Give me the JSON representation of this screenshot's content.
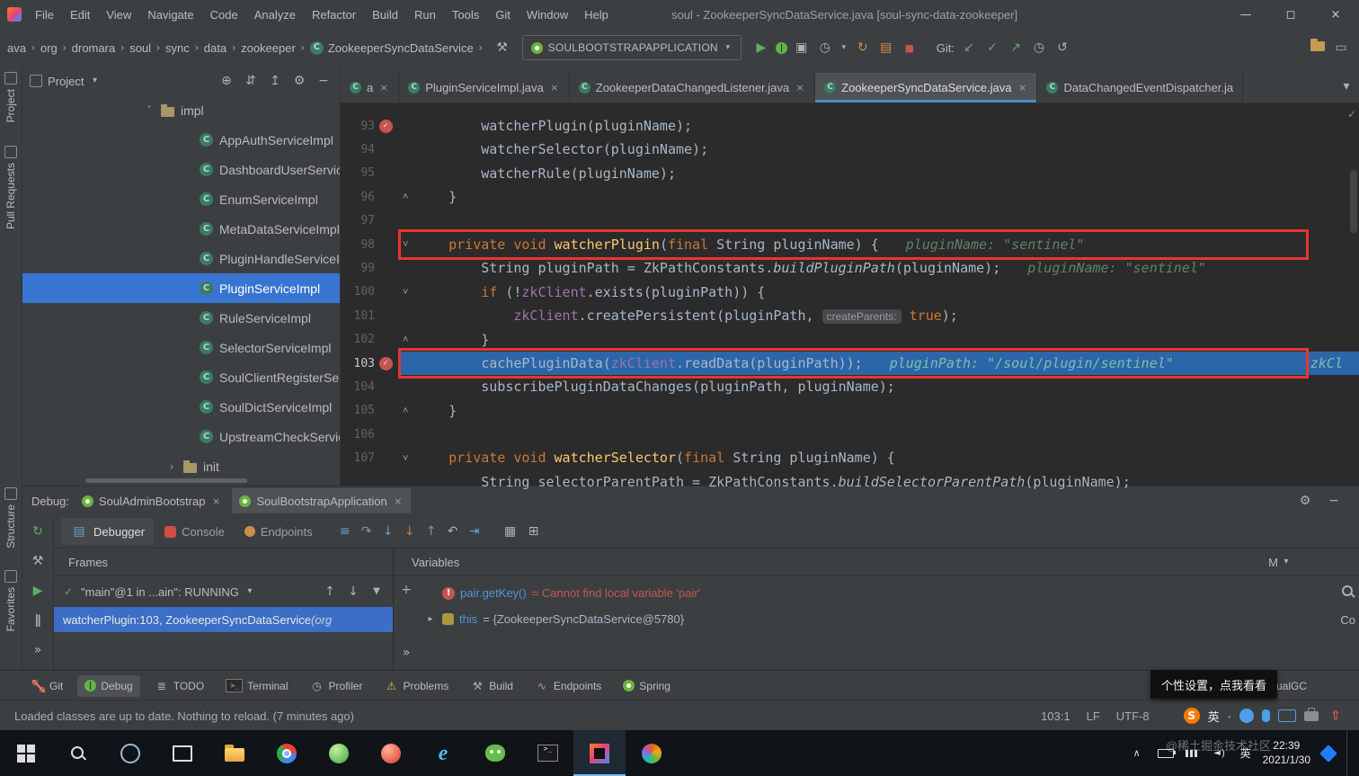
{
  "window_title": "soul - ZookeeperSyncDataService.java [soul-sync-data-zookeeper]",
  "menu_bar": [
    "File",
    "Edit",
    "View",
    "Navigate",
    "Code",
    "Analyze",
    "Refactor",
    "Build",
    "Run",
    "Tools",
    "Git",
    "Window",
    "Help"
  ],
  "nav": {
    "breadcrumbs": [
      "ava",
      "org",
      "dromara",
      "soul",
      "sync",
      "data",
      "zookeeper"
    ],
    "breadcrumb_class": "ZookeeperSyncDataService",
    "run_config": "SOULBOOTSTRAPAPPLICATION",
    "git_label": "Git:"
  },
  "stripes": {
    "top": [
      "Project",
      "Pull Requests"
    ],
    "bottom": [
      "Structure",
      "Favorites"
    ]
  },
  "project": {
    "title": "Project",
    "folder": "impl",
    "classes": [
      "AppAuthServiceImpl",
      "DashboardUserServiceI",
      "EnumServiceImpl",
      "MetaDataServiceImpl",
      "PluginHandleServiceIm",
      "PluginServiceImpl",
      "RuleServiceImpl",
      "SelectorServiceImpl",
      "SoulClientRegisterServ",
      "SoulDictServiceImpl",
      "UpstreamCheckService"
    ],
    "selected": "PluginServiceImpl",
    "trailing_folder": "init"
  },
  "editor": {
    "tabs": [
      {
        "label": "a",
        "close": true
      },
      {
        "label": "PluginServiceImpl.java",
        "close": true
      },
      {
        "label": "ZookeeperDataChangedListener.java",
        "close": true
      },
      {
        "label": "ZookeeperSyncDataService.java",
        "close": true,
        "active": true
      },
      {
        "label": "DataChangedEventDispatcher.ja",
        "close": false
      }
    ],
    "lines": [
      {
        "n": "93",
        "bp": true,
        "seg": [
          [
            "p",
            "        watcherPlugin(pluginName);"
          ]
        ]
      },
      {
        "n": "94",
        "seg": [
          [
            "p",
            "        watcherSelector(pluginName);"
          ]
        ]
      },
      {
        "n": "95",
        "seg": [
          [
            "p",
            "        watcherRule(pluginName);"
          ]
        ]
      },
      {
        "n": "96",
        "fold": "up",
        "seg": [
          [
            "p",
            "    }"
          ]
        ]
      },
      {
        "n": "97",
        "seg": []
      },
      {
        "n": "98",
        "fold": "down",
        "box": true,
        "seg": [
          [
            "p",
            "    "
          ],
          [
            "k",
            "private"
          ],
          [
            "p",
            " "
          ],
          [
            "k",
            "void"
          ],
          [
            "p",
            " "
          ],
          [
            "d",
            "watcherPlugin"
          ],
          [
            "p",
            "("
          ],
          [
            "k",
            "final"
          ],
          [
            "p",
            " String pluginName) {"
          ],
          [
            "h",
            "pluginName: \"sentinel\""
          ]
        ]
      },
      {
        "n": "99",
        "seg": [
          [
            "p",
            "        String pluginPath = ZkPathConstants."
          ],
          [
            "s",
            "buildPluginPath"
          ],
          [
            "p",
            "(pluginName);"
          ],
          [
            "h",
            "pluginName: \"sentinel\""
          ]
        ]
      },
      {
        "n": "100",
        "fold": "down",
        "seg": [
          [
            "p",
            "        "
          ],
          [
            "k",
            "if"
          ],
          [
            "p",
            " (!"
          ],
          [
            "f",
            "zkClient"
          ],
          [
            "p",
            ".exists(pluginPath)) {"
          ]
        ]
      },
      {
        "n": "101",
        "seg": [
          [
            "p",
            "            "
          ],
          [
            "f",
            "zkClient"
          ],
          [
            "p",
            ".createPersistent(pluginPath, "
          ],
          [
            "b",
            "createParents:"
          ],
          [
            "p",
            " "
          ],
          [
            "k",
            "true"
          ],
          [
            "p",
            ");"
          ]
        ]
      },
      {
        "n": "102",
        "fold": "up",
        "seg": [
          [
            "p",
            "        }"
          ]
        ]
      },
      {
        "n": "103",
        "bp": true,
        "exec": true,
        "box": true,
        "rhint": "zkCl",
        "seg": [
          [
            "p",
            "        cachePluginData("
          ],
          [
            "f",
            "zkClient"
          ],
          [
            "p",
            ".readData(pluginPath));"
          ],
          [
            "hx",
            "pluginPath: \"/soul/plugin/sentinel\""
          ]
        ]
      },
      {
        "n": "104",
        "seg": [
          [
            "p",
            "        subscribePluginDataChanges(pluginPath, pluginName);"
          ]
        ]
      },
      {
        "n": "105",
        "fold": "up",
        "seg": [
          [
            "p",
            "    }"
          ]
        ]
      },
      {
        "n": "106",
        "seg": []
      },
      {
        "n": "107",
        "fold": "down",
        "seg": [
          [
            "p",
            "    "
          ],
          [
            "k",
            "private"
          ],
          [
            "p",
            " "
          ],
          [
            "k",
            "void"
          ],
          [
            "p",
            " "
          ],
          [
            "d",
            "watcherSelector"
          ],
          [
            "p",
            "("
          ],
          [
            "k",
            "final"
          ],
          [
            "p",
            " String pluginName) {"
          ]
        ]
      },
      {
        "n": "",
        "partial": true,
        "seg": [
          [
            "p",
            "        String selectorParentPath = ZkPathConstants."
          ],
          [
            "s",
            "buildSelectorParentPath"
          ],
          [
            "p",
            "(pluginName);"
          ]
        ]
      }
    ]
  },
  "debug": {
    "label": "Debug:",
    "sessions": [
      {
        "label": "SoulAdminBootstrap"
      },
      {
        "label": "SoulBootstrapApplication",
        "active": true
      }
    ],
    "views": [
      {
        "label": "Debugger",
        "icon": "debugger",
        "active": true
      },
      {
        "label": "Console",
        "icon": "console"
      },
      {
        "label": "Endpoints",
        "icon": "endpoint"
      }
    ],
    "frames": {
      "title": "Frames",
      "thread": "\"main\"@1 in ...ain\": RUNNING",
      "frame": "watcherPlugin:103, ZookeeperSyncDataService ",
      "frame_suffix": "(org"
    },
    "variables": {
      "title": "Variables",
      "memory_label": "M",
      "side_label": "Co",
      "rows": [
        {
          "name": "pair.getKey()",
          "sep": " = ",
          "value": "Cannot find local variable 'pair'",
          "error": true
        },
        {
          "name": "this",
          "sep": " = ",
          "value": "{ZookeeperSyncDataService@5780}",
          "expandable": true
        }
      ]
    }
  },
  "tool_bar": {
    "items": [
      {
        "label": "Git",
        "icon": "git-branch"
      },
      {
        "label": "Debug",
        "icon": "debug-bug",
        "active": true
      },
      {
        "label": "TODO",
        "icon": "todo"
      },
      {
        "label": "Terminal",
        "icon": "terminal"
      },
      {
        "label": "Profiler",
        "icon": "profiler"
      },
      {
        "label": "Problems",
        "icon": "problems"
      },
      {
        "label": "Build",
        "icon": "build-hammer"
      },
      {
        "label": "Endpoints",
        "icon": "endpoints"
      },
      {
        "label": "Spring",
        "icon": "spring"
      }
    ],
    "right_label": "VisualGC"
  },
  "tooltip": "个性设置，点我看看",
  "status": {
    "message": "Loaded classes are up to date. Nothing to reload. (7 minutes ago)",
    "caret": "103:1",
    "line_sep": "LF",
    "encoding": "UTF-8",
    "ime": "英"
  },
  "taskbar": {
    "ime": "英",
    "time": "22:39",
    "date": "2021/1/30",
    "watermark": "@稀土掘金技术社区"
  },
  "icons": {
    "window_controls": [
      "win-min",
      "win-max",
      "win-close"
    ],
    "nav_left": [
      "build-hammer"
    ],
    "nav_run": [
      "run",
      "debug-bug",
      "coverage",
      "profiler"
    ],
    "nav_extra": [
      "hot-swap",
      "thread-dump",
      "stop"
    ],
    "nav_git": [
      "update",
      "commit",
      "push",
      "history",
      "rollback"
    ],
    "nav_end": [
      "folder",
      "monitor"
    ],
    "project_header": [
      "locate",
      "expand-all",
      "collapse-all",
      "gear",
      "hide"
    ],
    "debug_left": [
      "rerun",
      "build-hammer",
      "resume",
      "pause",
      "more"
    ],
    "debug_header_right": [
      "gear",
      "hide"
    ],
    "debug_steps": [
      "show-exec",
      "step-over",
      "step-into",
      "force-step-into",
      "step-out",
      "drop-frame",
      "run-to-cursor"
    ],
    "debug_aux": [
      "evaluate",
      "layout"
    ],
    "frames_toolbar": [
      "up",
      "down",
      "filter"
    ],
    "variables_side": [
      "add",
      "more"
    ],
    "variables_right": [
      "search"
    ],
    "sogou": [
      "emoji",
      "mic",
      "keyboard",
      "toolbox",
      "skin"
    ],
    "taskbar_apps": [
      "start",
      "tsearch",
      "cortana",
      "task-view",
      "explorer",
      "chrome",
      "sphere",
      "browser-red",
      "ie",
      "wechat",
      "cmd",
      "idea",
      "media"
    ],
    "taskbar_active": "idea",
    "tray": [
      "tray-expand",
      "battery",
      "network",
      "volume"
    ]
  },
  "colors": {
    "accent_blue": "#4A88C7",
    "exec_line": "#2D65A9",
    "selection_blue": "#3875D1",
    "breakpoint_red": "#C75450",
    "annotation_red": "#E8352F",
    "run_green": "#5FAD65"
  }
}
